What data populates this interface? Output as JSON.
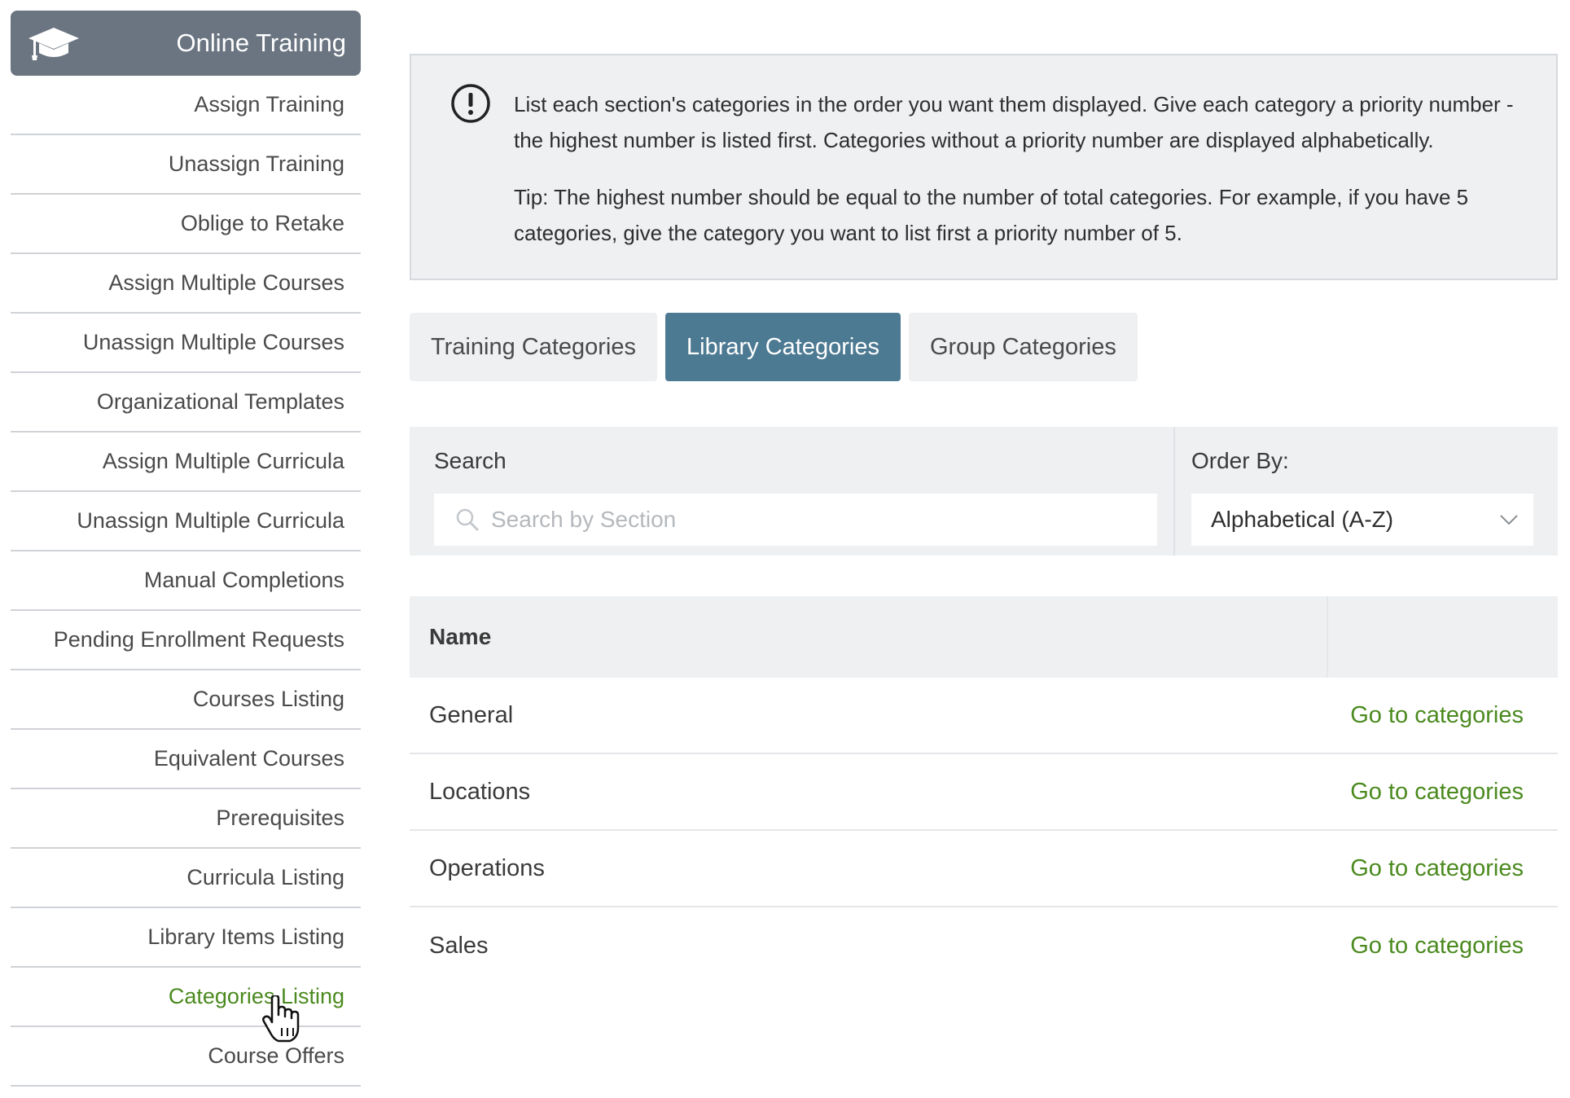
{
  "sidebar": {
    "title": "Online Training",
    "items": [
      {
        "label": "Assign Training"
      },
      {
        "label": "Unassign Training"
      },
      {
        "label": "Oblige to Retake"
      },
      {
        "label": "Assign Multiple Courses"
      },
      {
        "label": "Unassign Multiple Courses"
      },
      {
        "label": "Organizational Templates"
      },
      {
        "label": "Assign Multiple Curricula"
      },
      {
        "label": "Unassign Multiple Curricula"
      },
      {
        "label": "Manual Completions"
      },
      {
        "label": "Pending Enrollment Requests"
      },
      {
        "label": "Courses Listing"
      },
      {
        "label": "Equivalent Courses"
      },
      {
        "label": "Prerequisites"
      },
      {
        "label": "Curricula Listing"
      },
      {
        "label": "Library Items Listing"
      },
      {
        "label": "Categories Listing",
        "active": true
      },
      {
        "label": "Course Offers"
      }
    ]
  },
  "info": {
    "paragraph1": "List each section's categories in the order you want them displayed. Give each category a priority number - the highest number is listed first. Categories without a priority number are displayed alphabetically.",
    "paragraph2": "Tip: The highest number should be equal to the number of total categories. For example, if you have 5 categories, give the category you want to list first a priority number of 5."
  },
  "tabs": [
    {
      "label": "Training Categories",
      "active": false
    },
    {
      "label": "Library Categories",
      "active": true
    },
    {
      "label": "Group Categories",
      "active": false
    }
  ],
  "filters": {
    "search_label": "Search",
    "search_placeholder": "Search by Section",
    "order_label": "Order By:",
    "order_value": "Alphabetical (A-Z)"
  },
  "table": {
    "header_name": "Name",
    "rows": [
      {
        "name": "General",
        "action": "Go to categories"
      },
      {
        "name": "Locations",
        "action": "Go to categories"
      },
      {
        "name": "Operations",
        "action": "Go to categories"
      },
      {
        "name": "Sales",
        "action": "Go to categories"
      }
    ]
  },
  "colors": {
    "sidebar_header": "#6b7582",
    "active_tab": "#4d7a93",
    "link_green": "#4b8a1f",
    "panel_gray": "#eef0f2"
  },
  "icons": {
    "header": "graduation-cap-icon",
    "info": "exclamation-circle-icon",
    "search": "magnifier-icon",
    "select": "chevron-down-icon",
    "cursor": "hand-pointer-icon"
  }
}
